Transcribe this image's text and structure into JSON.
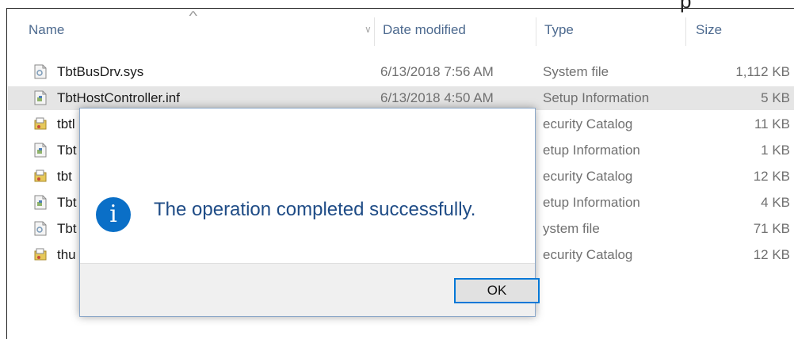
{
  "explorer": {
    "columns": {
      "name": "Name",
      "date_modified": "Date modified",
      "type": "Type",
      "size": "Size"
    },
    "files": [
      {
        "name": "TbtBusDrv.sys",
        "date": "6/13/2018 7:56 AM",
        "type": "System file",
        "size": "1,112 KB",
        "icon": "system-file-icon"
      },
      {
        "name": "TbtHostController.inf",
        "date": "6/13/2018 4:50 AM",
        "type": "Setup Information",
        "size": "5 KB",
        "icon": "setup-information-icon",
        "selected": true
      },
      {
        "name": "tbtl",
        "date": "",
        "type": "ecurity Catalog",
        "size": "11 KB",
        "icon": "security-catalog-icon"
      },
      {
        "name": "Tbt",
        "date": "",
        "type": "etup Information",
        "size": "1 KB",
        "icon": "setup-information-icon"
      },
      {
        "name": "tbt",
        "date": "",
        "type": "ecurity Catalog",
        "size": "12 KB",
        "icon": "security-catalog-icon"
      },
      {
        "name": "Tbt",
        "date": "",
        "type": "etup Information",
        "size": "4 KB",
        "icon": "setup-information-icon"
      },
      {
        "name": "Tbt",
        "date": "",
        "type": "ystem file",
        "size": "71 KB",
        "icon": "system-file-icon"
      },
      {
        "name": "thu",
        "date": "",
        "type": "ecurity Catalog",
        "size": "12 KB",
        "icon": "security-catalog-icon"
      }
    ]
  },
  "dialog": {
    "message": "The operation completed successfully.",
    "ok_label": "OK",
    "icon": "info-icon",
    "accent_color": "#0a6fc7",
    "message_color": "#1f4c86"
  }
}
